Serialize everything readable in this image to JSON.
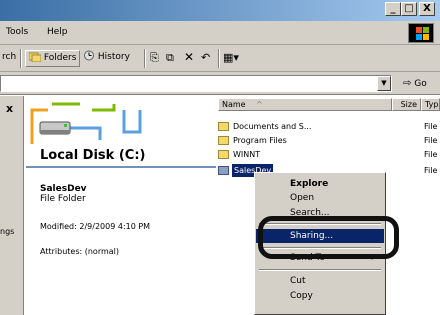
{
  "window": {
    "min_label": "_",
    "max_label": "□",
    "close_label": "X"
  },
  "menu": {
    "items": [
      "Tools",
      "Help"
    ]
  },
  "toolbar": {
    "search_label": "rch",
    "folders_label": "Folders",
    "history_label": "History"
  },
  "address": {
    "go_label": "Go"
  },
  "info_pane": {
    "disk_title": "Local Disk (C:)",
    "item_name": "SalesDev",
    "item_type": "File Folder",
    "modified": "Modified: 2/9/2009 4:10 PM",
    "attributes": "Attributes: (normal)",
    "left_cut": "ngs"
  },
  "file_list": {
    "columns": [
      "Name",
      "Size",
      "Typ"
    ],
    "rows": [
      {
        "name": "Documents and S...",
        "type": "File"
      },
      {
        "name": "Program Files",
        "type": "File"
      },
      {
        "name": "WINNT",
        "type": "File"
      },
      {
        "name": "SalesDev",
        "type": "File"
      }
    ]
  },
  "context_menu": {
    "items": [
      "Explore",
      "Open",
      "Search...",
      "Sharing...",
      "Send To",
      "Cut",
      "Copy"
    ],
    "submenu_arrow": "▶"
  }
}
